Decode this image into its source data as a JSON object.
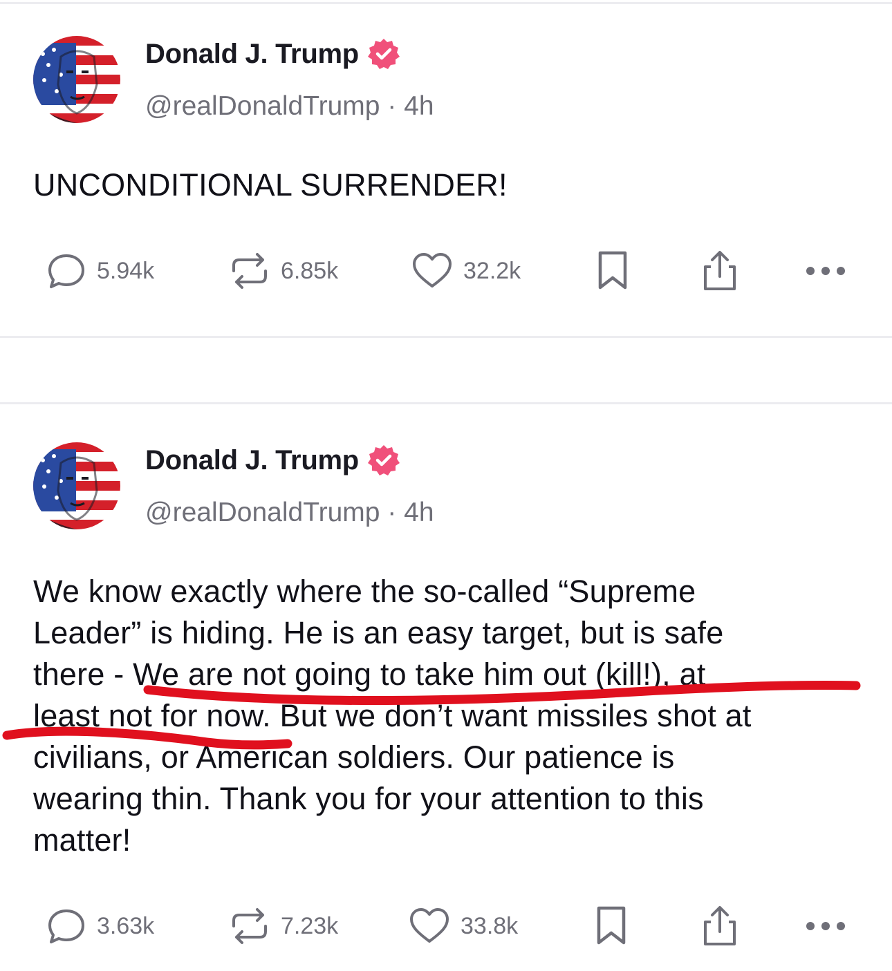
{
  "posts": [
    {
      "author": {
        "name": "Donald J. Trump",
        "handle": "@realDonaldTrump",
        "time": "4h",
        "separator": "·"
      },
      "text": "UNCONDITIONAL SURRENDER!",
      "stats": {
        "replies": "5.94k",
        "reposts": "6.85k",
        "likes": "32.2k"
      }
    },
    {
      "author": {
        "name": "Donald J. Trump",
        "handle": "@realDonaldTrump",
        "time": "4h",
        "separator": "·"
      },
      "text_lines": [
        "We know exactly where the so-called “Supreme",
        "Leader” is hiding. He is an easy target, but is safe",
        "there - We are not going to take him out (kill!), at",
        "least not for now. But we don’t want missiles shot at",
        "civilians, or American soldiers. Our patience is",
        "wearing thin. Thank you for your attention to this",
        "matter!"
      ],
      "stats": {
        "replies": "3.63k",
        "reposts": "7.23k",
        "likes": "33.8k"
      }
    }
  ],
  "colors": {
    "verified_badge": "#f0507a",
    "annotation_marker": "#e0101e",
    "stat_text": "#6f6f78"
  },
  "icons": [
    "reply-icon",
    "repost-icon",
    "like-icon",
    "bookmark-icon",
    "share-icon",
    "more-icon",
    "verified-badge-icon"
  ]
}
